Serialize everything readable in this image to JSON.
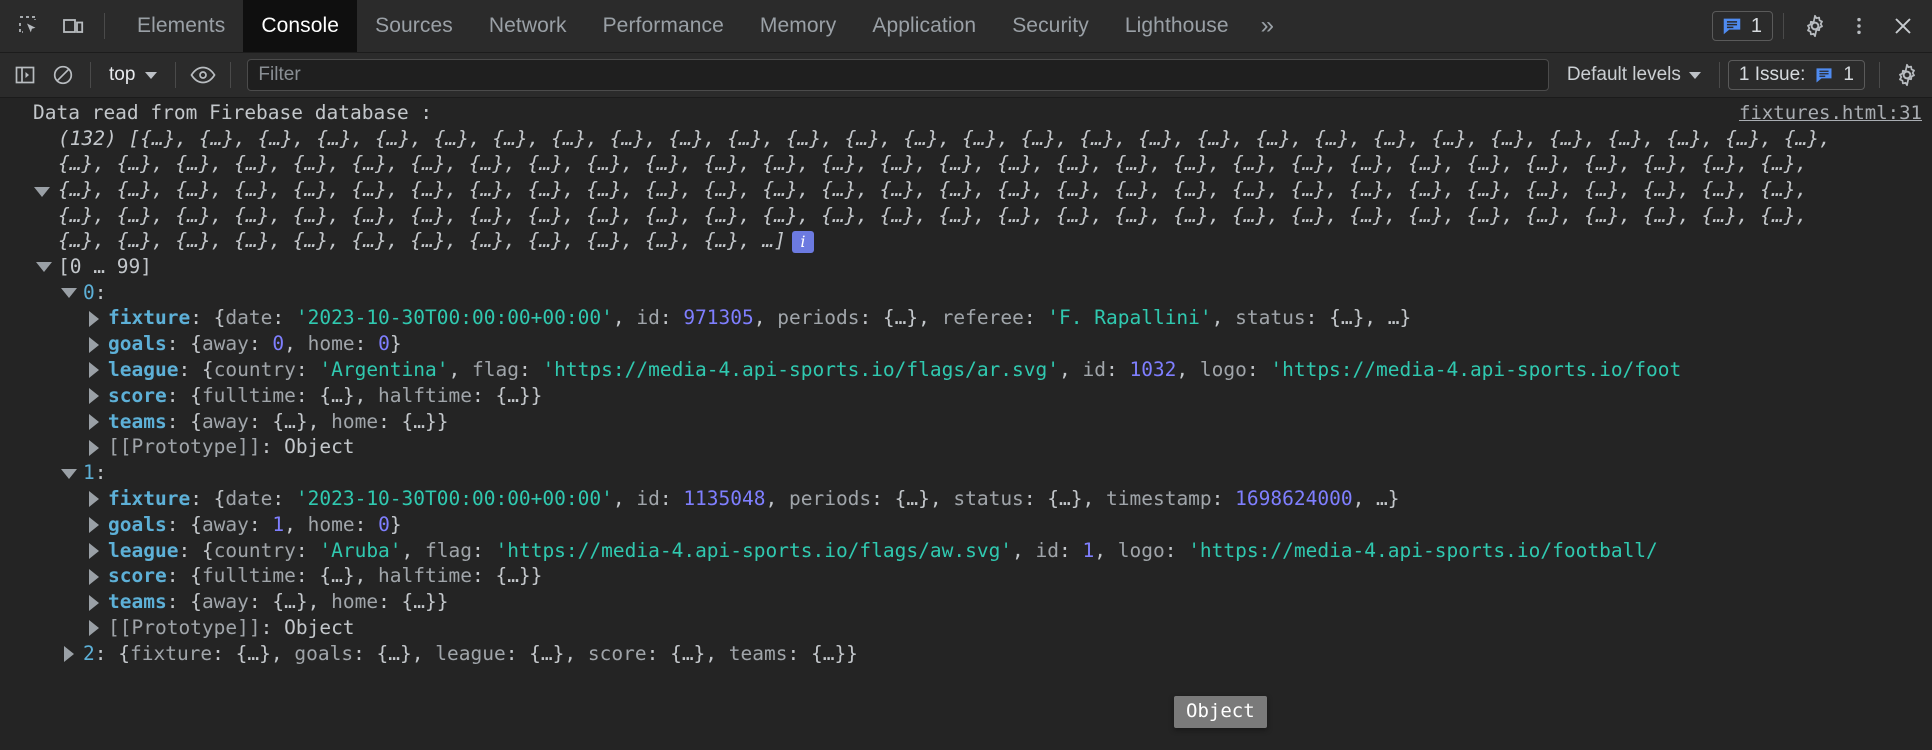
{
  "window": {
    "title": "DevTools - Console"
  },
  "tabbar": {
    "inspect_icon": "inspect-element-icon",
    "device_icon": "device-toolbar-icon",
    "tabs": [
      {
        "label": "Elements",
        "selected": false
      },
      {
        "label": "Console",
        "selected": true
      },
      {
        "label": "Sources",
        "selected": false
      },
      {
        "label": "Network",
        "selected": false
      },
      {
        "label": "Performance",
        "selected": false
      },
      {
        "label": "Memory",
        "selected": false
      },
      {
        "label": "Application",
        "selected": false
      },
      {
        "label": "Security",
        "selected": false
      },
      {
        "label": "Lighthouse",
        "selected": false
      }
    ],
    "more_tabs_label": "»",
    "issues_count": "1",
    "settings_icon": "gear-icon",
    "more_options_icon": "kebab-menu-icon",
    "close_icon": "close-icon"
  },
  "console_toolbar": {
    "sidebar_toggle_icon": "console-sidebar-icon",
    "clear_icon": "clear-console-icon",
    "context_selector": "top",
    "eye_icon": "live-expression-icon",
    "filter": {
      "value": "",
      "placeholder": "Filter"
    },
    "levels_label": "Default levels",
    "issues_label": "1 Issue:",
    "issues_count": "1",
    "settings_icon": "console-settings-icon"
  },
  "console": {
    "message": {
      "text": "Data read from Firebase database :",
      "source_link": "fixtures.html:31"
    },
    "array_preview": {
      "count": "(132)",
      "open": "[",
      "items_per_line": 22,
      "total_placeholders": 131,
      "placeholder": "{…}",
      "ellipsis": "…",
      "close": "]",
      "info_badge": "i"
    },
    "tree": [
      {
        "indent": 1,
        "arrow": "down",
        "tokens": [
          {
            "t": "[0 … 99]",
            "c": "k-plain"
          }
        ]
      },
      {
        "indent": 2,
        "arrow": "down",
        "tokens": [
          {
            "t": "0",
            "c": "k-numidx"
          },
          {
            "t": ":",
            "c": "k-plain"
          }
        ]
      },
      {
        "indent": 3,
        "arrow": "right",
        "tokens": [
          {
            "t": "fixture",
            "c": "k-prop"
          },
          {
            "t": ": {",
            "c": "k-plain"
          },
          {
            "t": "date",
            "c": "k-key"
          },
          {
            "t": ": ",
            "c": "k-plain"
          },
          {
            "t": "'2023-10-30T00:00:00+00:00'",
            "c": "k-str"
          },
          {
            "t": ", ",
            "c": "k-plain"
          },
          {
            "t": "id",
            "c": "k-key"
          },
          {
            "t": ": ",
            "c": "k-plain"
          },
          {
            "t": "971305",
            "c": "k-num"
          },
          {
            "t": ", ",
            "c": "k-plain"
          },
          {
            "t": "periods",
            "c": "k-key"
          },
          {
            "t": ": {…}, ",
            "c": "k-plain"
          },
          {
            "t": "referee",
            "c": "k-key"
          },
          {
            "t": ": ",
            "c": "k-plain"
          },
          {
            "t": "'F. Rapallini'",
            "c": "k-str"
          },
          {
            "t": ", ",
            "c": "k-plain"
          },
          {
            "t": "status",
            "c": "k-key"
          },
          {
            "t": ": {…}, …}",
            "c": "k-plain"
          }
        ]
      },
      {
        "indent": 3,
        "arrow": "right",
        "tokens": [
          {
            "t": "goals",
            "c": "k-prop"
          },
          {
            "t": ": {",
            "c": "k-plain"
          },
          {
            "t": "away",
            "c": "k-key"
          },
          {
            "t": ": ",
            "c": "k-plain"
          },
          {
            "t": "0",
            "c": "k-num"
          },
          {
            "t": ", ",
            "c": "k-plain"
          },
          {
            "t": "home",
            "c": "k-key"
          },
          {
            "t": ": ",
            "c": "k-plain"
          },
          {
            "t": "0",
            "c": "k-num"
          },
          {
            "t": "}",
            "c": "k-plain"
          }
        ]
      },
      {
        "indent": 3,
        "arrow": "right",
        "tokens": [
          {
            "t": "league",
            "c": "k-prop"
          },
          {
            "t": ": {",
            "c": "k-plain"
          },
          {
            "t": "country",
            "c": "k-key"
          },
          {
            "t": ": ",
            "c": "k-plain"
          },
          {
            "t": "'Argentina'",
            "c": "k-str"
          },
          {
            "t": ", ",
            "c": "k-plain"
          },
          {
            "t": "flag",
            "c": "k-key"
          },
          {
            "t": ": ",
            "c": "k-plain"
          },
          {
            "t": "'https://media-4.api-sports.io/flags/ar.svg'",
            "c": "k-str"
          },
          {
            "t": ", ",
            "c": "k-plain"
          },
          {
            "t": "id",
            "c": "k-key"
          },
          {
            "t": ": ",
            "c": "k-plain"
          },
          {
            "t": "1032",
            "c": "k-num"
          },
          {
            "t": ", ",
            "c": "k-plain"
          },
          {
            "t": "logo",
            "c": "k-key"
          },
          {
            "t": ": ",
            "c": "k-plain"
          },
          {
            "t": "'https://media-4.api-sports.io/foot",
            "c": "k-str"
          }
        ]
      },
      {
        "indent": 3,
        "arrow": "right",
        "tokens": [
          {
            "t": "score",
            "c": "k-prop"
          },
          {
            "t": ": {",
            "c": "k-plain"
          },
          {
            "t": "fulltime",
            "c": "k-key"
          },
          {
            "t": ": {…}, ",
            "c": "k-plain"
          },
          {
            "t": "halftime",
            "c": "k-key"
          },
          {
            "t": ": {…}}",
            "c": "k-plain"
          }
        ]
      },
      {
        "indent": 3,
        "arrow": "right",
        "tokens": [
          {
            "t": "teams",
            "c": "k-prop"
          },
          {
            "t": ": {",
            "c": "k-plain"
          },
          {
            "t": "away",
            "c": "k-key"
          },
          {
            "t": ": {…}, ",
            "c": "k-plain"
          },
          {
            "t": "home",
            "c": "k-key"
          },
          {
            "t": ": {…}}",
            "c": "k-plain"
          }
        ]
      },
      {
        "indent": 3,
        "arrow": "right",
        "tokens": [
          {
            "t": "[[Prototype]]",
            "c": "k-key"
          },
          {
            "t": ": Object",
            "c": "k-plain"
          }
        ]
      },
      {
        "indent": 2,
        "arrow": "down",
        "tokens": [
          {
            "t": "1",
            "c": "k-numidx"
          },
          {
            "t": ":",
            "c": "k-plain"
          }
        ]
      },
      {
        "indent": 3,
        "arrow": "right",
        "tokens": [
          {
            "t": "fixture",
            "c": "k-prop"
          },
          {
            "t": ": {",
            "c": "k-plain"
          },
          {
            "t": "date",
            "c": "k-key"
          },
          {
            "t": ": ",
            "c": "k-plain"
          },
          {
            "t": "'2023-10-30T00:00:00+00:00'",
            "c": "k-str"
          },
          {
            "t": ", ",
            "c": "k-plain"
          },
          {
            "t": "id",
            "c": "k-key"
          },
          {
            "t": ": ",
            "c": "k-plain"
          },
          {
            "t": "1135048",
            "c": "k-num"
          },
          {
            "t": ", ",
            "c": "k-plain"
          },
          {
            "t": "periods",
            "c": "k-key"
          },
          {
            "t": ": {…}, ",
            "c": "k-plain"
          },
          {
            "t": "status",
            "c": "k-key"
          },
          {
            "t": ": {…}, ",
            "c": "k-plain"
          },
          {
            "t": "timestamp",
            "c": "k-key"
          },
          {
            "t": ": ",
            "c": "k-plain"
          },
          {
            "t": "1698624000",
            "c": "k-num"
          },
          {
            "t": ", …}",
            "c": "k-plain"
          }
        ]
      },
      {
        "indent": 3,
        "arrow": "right",
        "tokens": [
          {
            "t": "goals",
            "c": "k-prop"
          },
          {
            "t": ": {",
            "c": "k-plain"
          },
          {
            "t": "away",
            "c": "k-key"
          },
          {
            "t": ": ",
            "c": "k-plain"
          },
          {
            "t": "1",
            "c": "k-num"
          },
          {
            "t": ", ",
            "c": "k-plain"
          },
          {
            "t": "home",
            "c": "k-key"
          },
          {
            "t": ": ",
            "c": "k-plain"
          },
          {
            "t": "0",
            "c": "k-num"
          },
          {
            "t": "}",
            "c": "k-plain"
          }
        ]
      },
      {
        "indent": 3,
        "arrow": "right",
        "tokens": [
          {
            "t": "league",
            "c": "k-prop"
          },
          {
            "t": ": {",
            "c": "k-plain"
          },
          {
            "t": "country",
            "c": "k-key"
          },
          {
            "t": ": ",
            "c": "k-plain"
          },
          {
            "t": "'Aruba'",
            "c": "k-str"
          },
          {
            "t": ", ",
            "c": "k-plain"
          },
          {
            "t": "flag",
            "c": "k-key"
          },
          {
            "t": ": ",
            "c": "k-plain"
          },
          {
            "t": "'https://media-4.api-sports.io/flags/aw.svg'",
            "c": "k-str"
          },
          {
            "t": ", ",
            "c": "k-plain"
          },
          {
            "t": "id",
            "c": "k-key"
          },
          {
            "t": ": ",
            "c": "k-plain"
          },
          {
            "t": "1",
            "c": "k-num"
          },
          {
            "t": ", ",
            "c": "k-plain"
          },
          {
            "t": "logo",
            "c": "k-key"
          },
          {
            "t": ": ",
            "c": "k-plain"
          },
          {
            "t": "'https://media-4.api-sports.io/football/",
            "c": "k-str"
          }
        ]
      },
      {
        "indent": 3,
        "arrow": "right",
        "tokens": [
          {
            "t": "score",
            "c": "k-prop"
          },
          {
            "t": ": {",
            "c": "k-plain"
          },
          {
            "t": "fulltime",
            "c": "k-key"
          },
          {
            "t": ": {…}, ",
            "c": "k-plain"
          },
          {
            "t": "halftime",
            "c": "k-key"
          },
          {
            "t": ": {…}}",
            "c": "k-plain"
          }
        ]
      },
      {
        "indent": 3,
        "arrow": "right",
        "tokens": [
          {
            "t": "teams",
            "c": "k-prop"
          },
          {
            "t": ": {",
            "c": "k-plain"
          },
          {
            "t": "away",
            "c": "k-key"
          },
          {
            "t": ": {…}, ",
            "c": "k-plain"
          },
          {
            "t": "home",
            "c": "k-key"
          },
          {
            "t": ": {…}}",
            "c": "k-plain"
          }
        ]
      },
      {
        "indent": 3,
        "arrow": "right",
        "tokens": [
          {
            "t": "[[Prototype]]",
            "c": "k-key"
          },
          {
            "t": ": Object",
            "c": "k-plain"
          }
        ]
      },
      {
        "indent": 2,
        "arrow": "right",
        "tokens": [
          {
            "t": "2",
            "c": "k-numidx"
          },
          {
            "t": ": {",
            "c": "k-plain"
          },
          {
            "t": "fixture",
            "c": "k-key"
          },
          {
            "t": ": {…}, ",
            "c": "k-plain"
          },
          {
            "t": "goals",
            "c": "k-key"
          },
          {
            "t": ": {…}, ",
            "c": "k-plain"
          },
          {
            "t": "league",
            "c": "k-key"
          },
          {
            "t": ": {…}, ",
            "c": "k-plain"
          },
          {
            "t": "score",
            "c": "k-key"
          },
          {
            "t": ": {…}, ",
            "c": "k-plain"
          },
          {
            "t": "teams",
            "c": "k-key"
          },
          {
            "t": ": {…}}",
            "c": "k-plain"
          }
        ]
      }
    ],
    "tooltip": {
      "text": "Object"
    }
  },
  "colors": {
    "background": "#242424",
    "toolbar": "#2b2b2b",
    "tab_selected_bg": "#0f0f0f",
    "string": "#30c9b0",
    "number": "#7f7fff",
    "property": "#5db0d7",
    "accent_blue": "#4f8bf0"
  }
}
